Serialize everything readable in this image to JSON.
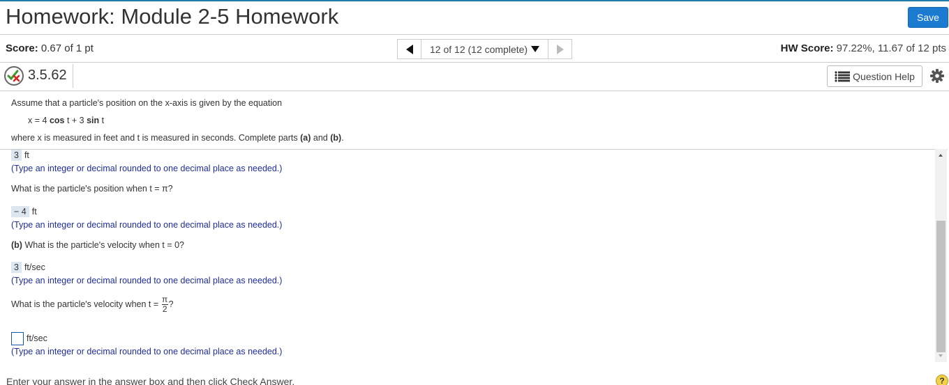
{
  "header": {
    "title": "Homework: Module 2-5 Homework",
    "save_label": "Save"
  },
  "score_bar": {
    "score_label": "Score:",
    "score_value": "0.67 of 1 pt",
    "nav_label": "12 of 12 (12 complete)",
    "hw_score_label": "HW Score:",
    "hw_score_value": "97.22%, 11.67 of 12 pts"
  },
  "question": {
    "number": "3.5.62",
    "help_label": "Question Help"
  },
  "problem": {
    "intro": "Assume that a particle's position on the x-axis is given by the equation",
    "eq_lhs": "x = 4",
    "eq_cos": "cos",
    "eq_mid": " t + 3 ",
    "eq_sin": "sin",
    "eq_end": " t",
    "where_text": "where x is measured in feet and t is measured in seconds. Complete parts",
    "part_a": "(a)",
    "and_text": "and",
    "part_b": "(b)"
  },
  "work": {
    "ans1": "3",
    "unit1": "ft",
    "hint": "(Type an integer or decimal rounded to one decimal place as needed.)",
    "q_position_pi": "What is the particle's position when t = π?",
    "ans2": "− 4",
    "unit2": "ft",
    "part_b_label": "(b)",
    "q_velocity_0": "What is the particle's velocity when t = 0?",
    "ans3": "3",
    "unit3": "ft/sec",
    "q_velocity_pi2_pre": "What is the particle's velocity when t =",
    "frac_num": "π",
    "frac_den": "2",
    "q_velocity_pi2_post": "?",
    "unit4": "ft/sec"
  },
  "footer": {
    "instruction": "Enter your answer in the answer box and then click Check Answer.",
    "help_symbol": "?"
  },
  "colors": {
    "accent": "#1a7bd0",
    "hint_text": "#1f2e9c",
    "answer_fill": "#dbe6ef"
  }
}
